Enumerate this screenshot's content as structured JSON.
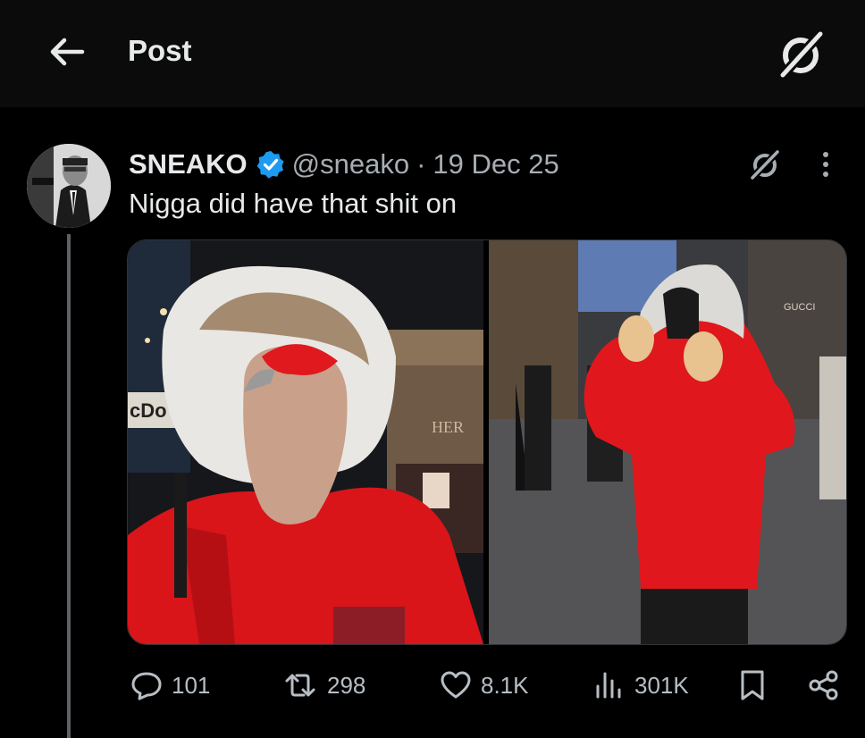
{
  "header": {
    "title": "Post",
    "back_icon": "arrow-left-icon",
    "grok_icon": "grok-icon"
  },
  "tweet": {
    "author_name": "SNEAKO",
    "verified": true,
    "handle": "@sneako",
    "separator": "·",
    "date": "19 Dec 25",
    "text": "Nigga did have that shit on",
    "media": [
      {
        "description_icon": "photo-icon",
        "storefront_text": "cDo",
        "sign_text": "HER"
      },
      {
        "description_icon": "photo-icon",
        "storefront_text": "GUCCI"
      }
    ]
  },
  "actions": {
    "replies": "101",
    "reposts": "298",
    "likes": "8.1K",
    "views": "301K"
  },
  "colors": {
    "background": "#000000",
    "text": "#e7e9ea",
    "muted": "#a7adb3",
    "verified_blue": "#1d9bf0",
    "jacket_red": "#e0171c"
  }
}
